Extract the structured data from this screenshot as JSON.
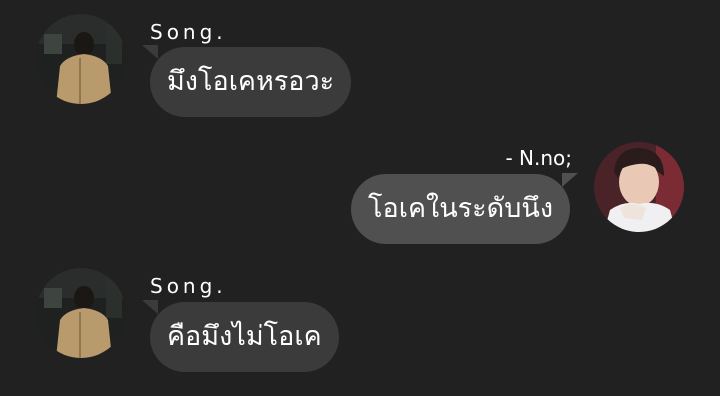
{
  "messages": [
    {
      "side": "left",
      "sender": "Song.",
      "text": "มึงโอเคหรอวะ"
    },
    {
      "side": "right",
      "sender": "- N.no;",
      "text": "โอเคในระดับนึง"
    },
    {
      "side": "left",
      "sender": "Song.",
      "text": "คือมึงไม่โอเค"
    }
  ],
  "colors": {
    "background": "#212121",
    "bubble_left": "#3b3b3b",
    "bubble_right": "#505050",
    "text": "#ffffff"
  }
}
